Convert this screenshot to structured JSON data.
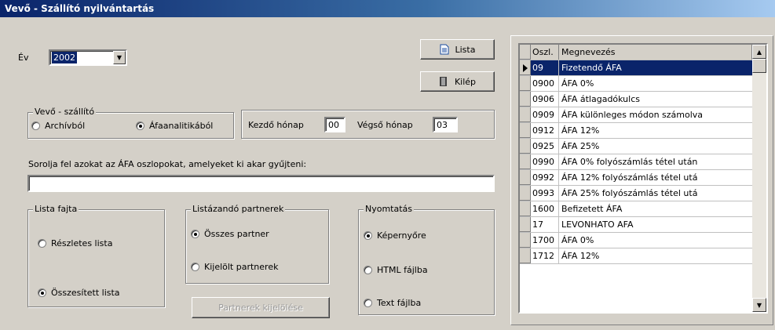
{
  "window": {
    "title": "Vevő - Szállító nyilvántartás"
  },
  "year": {
    "label": "Év",
    "value": "2002"
  },
  "buttons": {
    "lista": "Lista",
    "kilep": "Kilép",
    "partnerek": "Partnerek kijelölése"
  },
  "vevo_szallito": {
    "legend": "Vevő - szállító",
    "opt1": "Archívból",
    "opt2": "Áfaanalitikából"
  },
  "months": {
    "start_label": "Kezdő hónap",
    "start_value": "00",
    "end_label": "Végső hónap",
    "end_value": "03"
  },
  "columns_prompt": {
    "label": "Sorolja fel azokat az ÁFA oszlopokat, amelyeket ki akar gyűjteni:",
    "value": ""
  },
  "lista_fajta": {
    "legend": "Lista fajta",
    "opt1": "Részletes lista",
    "opt2": "Összesített lista"
  },
  "partners": {
    "legend": "Listázandó partnerek",
    "opt1": "Összes partner",
    "opt2": "Kijelölt partnerek"
  },
  "print": {
    "legend": "Nyomtatás",
    "opt1": "Képernyőre",
    "opt2": "HTML fájlba",
    "opt3": "Text fájlba"
  },
  "grid": {
    "headers": [
      "Oszl.",
      "Megnevezés"
    ],
    "rows": [
      [
        "09",
        "Fizetendő ÁFA"
      ],
      [
        "0900",
        "ÁFA  0%"
      ],
      [
        "0906",
        "ÁFA átlagadókulcs"
      ],
      [
        "0909",
        "ÁFA különleges módon számolva"
      ],
      [
        "0912",
        "ÁFA 12%"
      ],
      [
        "0925",
        "ÁFA 25%"
      ],
      [
        "0990",
        "ÁFA 0% folyószámlás tétel után"
      ],
      [
        "0992",
        "ÁFA 12% folyószámlás tétel utá"
      ],
      [
        "0993",
        "ÁFA 25% folyószámlás tétel utá"
      ],
      [
        "1600",
        "Befizetett ÁFA"
      ],
      [
        "17",
        "LEVONHATO AFA"
      ],
      [
        "1700",
        "ÁFA  0%"
      ],
      [
        "1712",
        "ÁFA 12%"
      ]
    ]
  }
}
